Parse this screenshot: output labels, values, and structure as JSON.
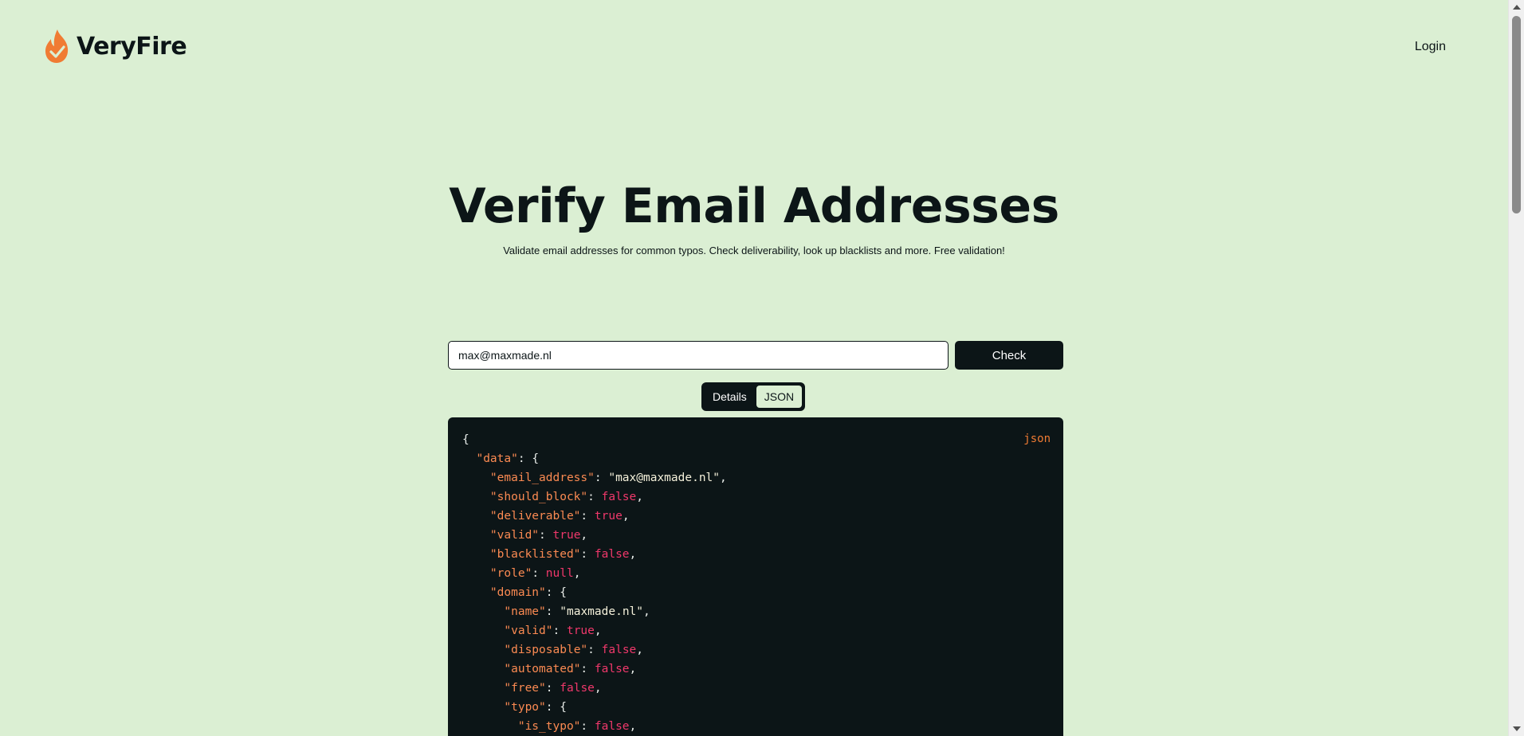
{
  "header": {
    "brand_name": "VeryFire",
    "login_label": "Login",
    "logo_icon": "flame-check-icon",
    "accent_color": "#f07b33"
  },
  "hero": {
    "title": "Verify Email Addresses",
    "subtitle": "Validate email addresses for common typos. Check deliverability, look up blacklists and more. Free validation!"
  },
  "form": {
    "email_value": "max@maxmade.nl",
    "check_label": "Check"
  },
  "view_toggle": {
    "details_label": "Details",
    "json_label": "JSON",
    "active": "JSON"
  },
  "code_block": {
    "language": "json",
    "lines": [
      [
        {
          "t": "punc",
          "v": "{"
        }
      ],
      [
        {
          "t": "punc",
          "v": "  "
        },
        {
          "t": "key",
          "v": "\"data\""
        },
        {
          "t": "punc",
          "v": ": {"
        }
      ],
      [
        {
          "t": "punc",
          "v": "    "
        },
        {
          "t": "key",
          "v": "\"email_address\""
        },
        {
          "t": "punc",
          "v": ": "
        },
        {
          "t": "str",
          "v": "\"max@maxmade.nl\""
        },
        {
          "t": "punc",
          "v": ","
        }
      ],
      [
        {
          "t": "punc",
          "v": "    "
        },
        {
          "t": "key",
          "v": "\"should_block\""
        },
        {
          "t": "punc",
          "v": ": "
        },
        {
          "t": "bool",
          "v": "false"
        },
        {
          "t": "punc",
          "v": ","
        }
      ],
      [
        {
          "t": "punc",
          "v": "    "
        },
        {
          "t": "key",
          "v": "\"deliverable\""
        },
        {
          "t": "punc",
          "v": ": "
        },
        {
          "t": "bool",
          "v": "true"
        },
        {
          "t": "punc",
          "v": ","
        }
      ],
      [
        {
          "t": "punc",
          "v": "    "
        },
        {
          "t": "key",
          "v": "\"valid\""
        },
        {
          "t": "punc",
          "v": ": "
        },
        {
          "t": "bool",
          "v": "true"
        },
        {
          "t": "punc",
          "v": ","
        }
      ],
      [
        {
          "t": "punc",
          "v": "    "
        },
        {
          "t": "key",
          "v": "\"blacklisted\""
        },
        {
          "t": "punc",
          "v": ": "
        },
        {
          "t": "bool",
          "v": "false"
        },
        {
          "t": "punc",
          "v": ","
        }
      ],
      [
        {
          "t": "punc",
          "v": "    "
        },
        {
          "t": "key",
          "v": "\"role\""
        },
        {
          "t": "punc",
          "v": ": "
        },
        {
          "t": "null",
          "v": "null"
        },
        {
          "t": "punc",
          "v": ","
        }
      ],
      [
        {
          "t": "punc",
          "v": "    "
        },
        {
          "t": "key",
          "v": "\"domain\""
        },
        {
          "t": "punc",
          "v": ": {"
        }
      ],
      [
        {
          "t": "punc",
          "v": "      "
        },
        {
          "t": "key",
          "v": "\"name\""
        },
        {
          "t": "punc",
          "v": ": "
        },
        {
          "t": "str",
          "v": "\"maxmade.nl\""
        },
        {
          "t": "punc",
          "v": ","
        }
      ],
      [
        {
          "t": "punc",
          "v": "      "
        },
        {
          "t": "key",
          "v": "\"valid\""
        },
        {
          "t": "punc",
          "v": ": "
        },
        {
          "t": "bool",
          "v": "true"
        },
        {
          "t": "punc",
          "v": ","
        }
      ],
      [
        {
          "t": "punc",
          "v": "      "
        },
        {
          "t": "key",
          "v": "\"disposable\""
        },
        {
          "t": "punc",
          "v": ": "
        },
        {
          "t": "bool",
          "v": "false"
        },
        {
          "t": "punc",
          "v": ","
        }
      ],
      [
        {
          "t": "punc",
          "v": "      "
        },
        {
          "t": "key",
          "v": "\"automated\""
        },
        {
          "t": "punc",
          "v": ": "
        },
        {
          "t": "bool",
          "v": "false"
        },
        {
          "t": "punc",
          "v": ","
        }
      ],
      [
        {
          "t": "punc",
          "v": "      "
        },
        {
          "t": "key",
          "v": "\"free\""
        },
        {
          "t": "punc",
          "v": ": "
        },
        {
          "t": "bool",
          "v": "false"
        },
        {
          "t": "punc",
          "v": ","
        }
      ],
      [
        {
          "t": "punc",
          "v": "      "
        },
        {
          "t": "key",
          "v": "\"typo\""
        },
        {
          "t": "punc",
          "v": ": {"
        }
      ],
      [
        {
          "t": "punc",
          "v": "        "
        },
        {
          "t": "key",
          "v": "\"is_typo\""
        },
        {
          "t": "punc",
          "v": ": "
        },
        {
          "t": "bool",
          "v": "false"
        },
        {
          "t": "punc",
          "v": ","
        }
      ]
    ]
  },
  "colors": {
    "background": "#dbefd3",
    "dark": "#0c1517",
    "json_key": "#fb8a52",
    "json_string": "#f4f0da",
    "json_literal": "#f0386b"
  }
}
